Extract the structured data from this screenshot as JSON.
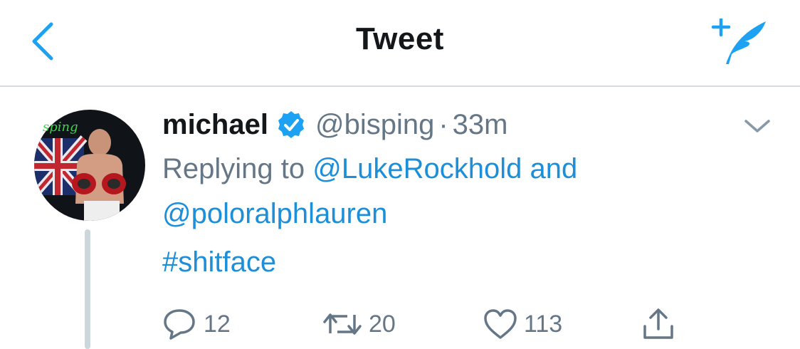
{
  "nav": {
    "title": "Tweet",
    "back_icon": "chevron-left-icon",
    "compose_icon": "compose-tweet-icon",
    "accent": "#1da1f2"
  },
  "tweet": {
    "name": "michael",
    "verified": true,
    "handle": "@bisping",
    "separator": "·",
    "time": "33m",
    "reply_prefix": "Replying to",
    "reply_mentions": [
      "@LukeRockhold",
      "@poloralphlauren"
    ],
    "reply_conjunction": "and",
    "text": "#shitface",
    "avatar_text": "sping"
  },
  "actions": {
    "replies": "12",
    "retweets": "20",
    "likes": "113"
  },
  "colors": {
    "link": "#1d8fd8",
    "muted": "#657786",
    "text": "#14171a",
    "divider": "#d6dbe0"
  }
}
